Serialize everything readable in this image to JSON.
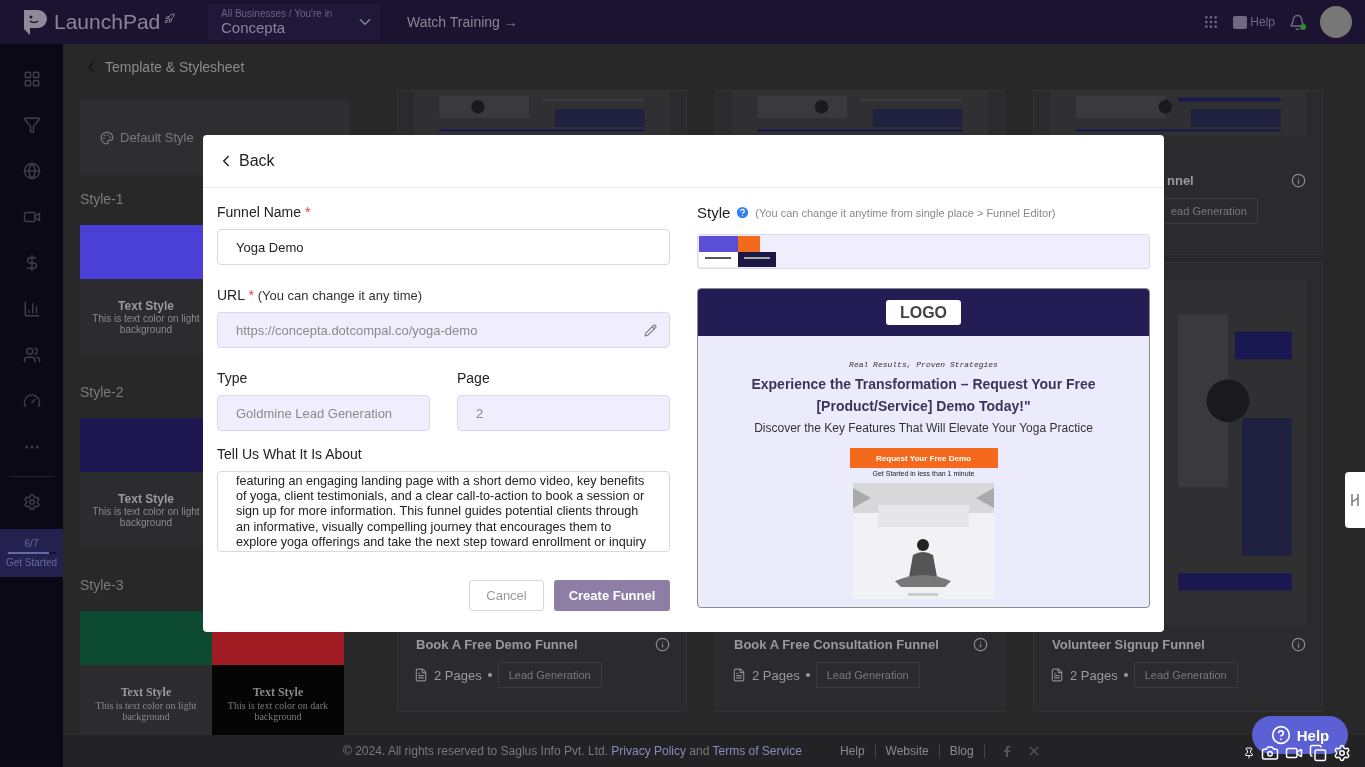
{
  "header": {
    "logo": "LaunchPad",
    "business": {
      "caption": "All Businesses / You're in",
      "name": "Concepta"
    },
    "training_link": "Watch Training →",
    "help": "Help"
  },
  "sidebar": {
    "progress": {
      "count": "6/7",
      "level": 0.86,
      "label": "Get Started"
    }
  },
  "breadcrumb": "Template & Stylesheet",
  "styles_panel": {
    "default_style": "Default Style",
    "styles": [
      {
        "title": "Style-1",
        "swatches": [
          {
            "color": "#4a40d8",
            "dark": false,
            "serif": false,
            "title": "Text Style",
            "text": "This is text color on light background"
          }
        ]
      },
      {
        "title": "Style-2",
        "swatches": [
          {
            "color": "#1e1650",
            "dark": false,
            "serif": false,
            "title": "Text Style",
            "text": "This is text color on light background"
          }
        ]
      },
      {
        "title": "Style-3",
        "swatches": [
          {
            "color": "#0d4a32",
            "dark": false,
            "serif": true,
            "title": "Text Style",
            "text": "This is text color on light background"
          },
          {
            "color": "#a11c22",
            "dark": true,
            "serif": true,
            "title": "Text Style",
            "text": "This is text color on dark background"
          }
        ]
      }
    ]
  },
  "funnels": [
    {
      "kind": "short",
      "thumbnail": true
    },
    {
      "kind": "short",
      "thumbnail": true
    },
    {
      "kind": "short",
      "thumbnail": true,
      "cut": true,
      "title": "nnel",
      "tag": "ead Generation"
    },
    {
      "kind": "tall",
      "title": "Book A Free Demo Funnel",
      "pages": "2 Pages",
      "tag": "Lead Generation"
    },
    {
      "kind": "tall",
      "title": "Book A Free Consultation Funnel",
      "pages": "2 Pages",
      "tag": "Lead Generation"
    },
    {
      "kind": "tall",
      "thumbnail": true,
      "title": "Volunteer Signup Funnel",
      "pages": "2 Pages",
      "tag": "Lead Generation"
    }
  ],
  "footer": {
    "copyright": "© 2024. All rights reserved to Saglus Info Pvt. Ltd.",
    "privacy": "Privacy Policy",
    "and": "and",
    "terms": "Terms of Service",
    "links": [
      "Help",
      "Website",
      "Blog"
    ]
  },
  "modal": {
    "back": "Back",
    "required_mark": "*",
    "name_label": "Funnel Name",
    "name_value": "Yoga Demo",
    "url_label": "URL",
    "url_note": "(You can change it any time)",
    "url_value": "https://concepta.dotcompal.co/yoga-demo",
    "type_label": "Type",
    "type_value": "Goldmine Lead Generation",
    "page_label": "Page",
    "page_value": "2",
    "about_label": "Tell Us What It Is About",
    "about_value": "featuring an engaging landing page with a short demo video, key benefits of yoga, client testimonials, and a clear call-to-action to book a session or sign up for more information. This funnel guides potential clients through an informative, visually compelling journey that encourages them to explore yoga offerings and take the next step toward enrollment or inquiry",
    "cancel": "Cancel",
    "create": "Create Funnel",
    "style_label": "Style",
    "style_note": "(You can change it anytime from single place > Funnel Editor)",
    "preview": {
      "logo": "LOGO",
      "kicker": "Real Results, Proven Strategies",
      "heading": "Experience the Transformation – Request Your Free [Product/Service] Demo Today!\"",
      "sub": "Discover the Key Features That Will Elevate Your Yoga Practice",
      "cta": "Request Your Free Demo",
      "cta_note": "Get Started in less than 1 minute"
    }
  },
  "help_button": "Help"
}
